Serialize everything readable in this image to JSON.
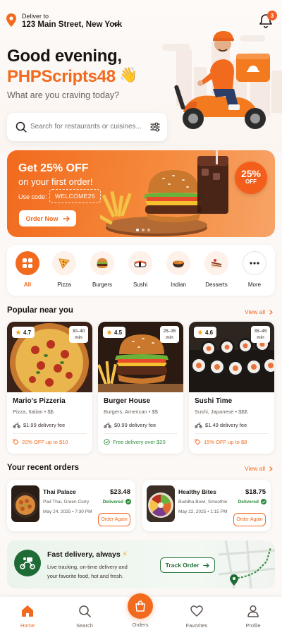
{
  "header": {
    "deliver_to_label": "Deliver to",
    "address": "123 Main Street, New York",
    "notification_count": "3"
  },
  "hero": {
    "greeting": "Good evening,",
    "username": "PHPScripts48",
    "wave_emoji": "👋",
    "subtitle": "What are you craving today?"
  },
  "search": {
    "placeholder": "Search for restaurants or cuisines..."
  },
  "promo": {
    "title": "Get 25% OFF",
    "subtitle": "on your first order!",
    "code_label": "Use code:",
    "code": "WELCOME25",
    "button": "Order Now",
    "badge_pct": "25%",
    "badge_word": "OFF",
    "dots": 3,
    "active_dot": 0
  },
  "categories": [
    {
      "label": "All",
      "icon": "grid-icon",
      "active": true
    },
    {
      "label": "Pizza",
      "icon": "pizza-icon"
    },
    {
      "label": "Burgers",
      "icon": "burger-icon"
    },
    {
      "label": "Sushi",
      "icon": "sushi-icon"
    },
    {
      "label": "Indian",
      "icon": "curry-icon"
    },
    {
      "label": "Desserts",
      "icon": "cake-icon"
    },
    {
      "label": "More",
      "icon": "more-icon"
    }
  ],
  "popular": {
    "title": "Popular near you",
    "view_all": "View all",
    "restaurants": [
      {
        "name": "Mario's Pizzeria",
        "cuisine": "Pizza, Italian • $$",
        "rating": "4.7",
        "eta_top": "30–40",
        "eta_unit": "min",
        "fee": "$1.99 delivery fee",
        "promo": "20% OFF up to $10",
        "promo_type": "tag-icon",
        "promo_color": "#f26a1e"
      },
      {
        "name": "Burger House",
        "cuisine": "Burgers, American • $$",
        "rating": "4.5",
        "eta_top": "25–35",
        "eta_unit": "min",
        "fee": "$0.99 delivery fee",
        "promo": "Free delivery over $20",
        "promo_type": "check-circle-icon",
        "promo_color": "#2e8b3a"
      },
      {
        "name": "Sushi Time",
        "cuisine": "Sushi, Japanese • $$$",
        "rating": "4.6",
        "eta_top": "35–45",
        "eta_unit": "min",
        "fee": "$1.49 delivery fee",
        "promo": "15% OFF up to $8",
        "promo_type": "tag-icon",
        "promo_color": "#f26a1e"
      }
    ]
  },
  "recent": {
    "title": "Your recent orders",
    "view_all": "View all",
    "orders": [
      {
        "name": "Thai Palace",
        "price": "$23.48",
        "items": "Pad Thai, Green Curry",
        "status": "Delivered",
        "date": "May 24, 2025 • 7:30 PM",
        "button": "Order Again"
      },
      {
        "name": "Healthy Bites",
        "price": "$18.75",
        "items": "Buddha Bowl, Smoothie",
        "status": "Delivered",
        "date": "May 22, 2025 • 1:15 PM",
        "button": "Order Again"
      }
    ]
  },
  "fast_delivery": {
    "title": "Fast delivery, always",
    "bolt": "⚡",
    "desc_line1": "Live tracking, on-time delivery and",
    "desc_line2": "your favorite food, hot and fresh.",
    "button": "Track Order"
  },
  "nav": {
    "home": "Home",
    "search": "Search",
    "orders": "Orders",
    "favorites": "Favorites",
    "profile": "Profile"
  },
  "colors": {
    "accent": "#f26a1e",
    "success": "#2e8b3a",
    "dark_green": "#1f6b35"
  }
}
